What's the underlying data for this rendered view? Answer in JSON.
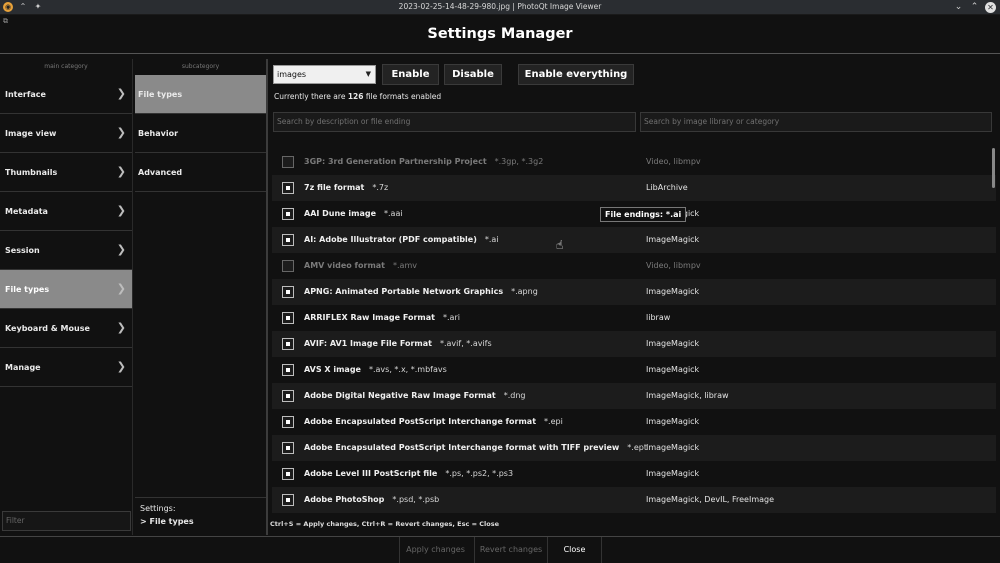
{
  "window": {
    "title": "2023-02-25-14-48-29-980.jpg | PhotoQt Image Viewer"
  },
  "header": {
    "title": "Settings Manager"
  },
  "main_category": {
    "heading": "main category",
    "items": [
      {
        "label": "Interface"
      },
      {
        "label": "Image view"
      },
      {
        "label": "Thumbnails"
      },
      {
        "label": "Metadata"
      },
      {
        "label": "Session"
      },
      {
        "label": "File types"
      },
      {
        "label": "Keyboard & Mouse"
      },
      {
        "label": "Manage"
      }
    ],
    "filter_placeholder": "Filter"
  },
  "sub_category": {
    "heading": "subcategory",
    "items": [
      {
        "label": "File types"
      },
      {
        "label": "Behavior"
      },
      {
        "label": "Advanced"
      }
    ],
    "settings_label": "Settings:",
    "settings_path": "> File types"
  },
  "content": {
    "select_value": "images",
    "enable_label": "Enable",
    "disable_label": "Disable",
    "enable_all_label": "Enable everything",
    "status_prefix": "Currently there are",
    "status_count": "126",
    "status_suffix": "file formats enabled",
    "search_desc_placeholder": "Search by description or file ending",
    "search_lib_placeholder": "Search by image library or category",
    "formats": [
      {
        "name": "3GP: 3rd Generation Partnership Project",
        "ext": "*.3gp, *.3g2",
        "lib": "Video, libmpv",
        "enabled": false
      },
      {
        "name": "7z file format",
        "ext": "*.7z",
        "lib": "LibArchive",
        "enabled": true
      },
      {
        "name": "AAI Dune image",
        "ext": "*.aai",
        "lib": "ImageMagick",
        "enabled": true
      },
      {
        "name": "AI: Adobe Illustrator (PDF compatible)",
        "ext": "*.ai",
        "lib": "ImageMagick",
        "enabled": true
      },
      {
        "name": "AMV video format",
        "ext": "*.amv",
        "lib": "Video, libmpv",
        "enabled": false
      },
      {
        "name": "APNG: Animated Portable Network Graphics",
        "ext": "*.apng",
        "lib": "ImageMagick",
        "enabled": true
      },
      {
        "name": "ARRIFLEX Raw Image Format",
        "ext": "*.ari",
        "lib": "libraw",
        "enabled": true
      },
      {
        "name": "AVIF: AV1 Image File Format",
        "ext": "*.avif, *.avifs",
        "lib": "ImageMagick",
        "enabled": true
      },
      {
        "name": "AVS X image",
        "ext": "*.avs, *.x, *.mbfavs",
        "lib": "ImageMagick",
        "enabled": true
      },
      {
        "name": "Adobe Digital Negative Raw Image Format",
        "ext": "*.dng",
        "lib": "ImageMagick, libraw",
        "enabled": true
      },
      {
        "name": "Adobe Encapsulated PostScript Interchange format",
        "ext": "*.epi",
        "lib": "ImageMagick",
        "enabled": true
      },
      {
        "name": "Adobe Encapsulated PostScript Interchange format with TIFF preview",
        "ext": "*.ept",
        "lib": "ImageMagick",
        "enabled": true
      },
      {
        "name": "Adobe Level III PostScript file",
        "ext": "*.ps, *.ps2, *.ps3",
        "lib": "ImageMagick",
        "enabled": true
      },
      {
        "name": "Adobe PhotoShop",
        "ext": "*.psd, *.psb",
        "lib": "ImageMagick, DevIL, FreeImage",
        "enabled": true
      }
    ],
    "tooltip": "File endings: *.ai",
    "shortcuts": "Ctrl+S = Apply changes, Ctrl+R = Revert changes, Esc = Close"
  },
  "footer": {
    "apply_label": "Apply changes",
    "revert_label": "Revert changes",
    "close_label": "Close"
  }
}
